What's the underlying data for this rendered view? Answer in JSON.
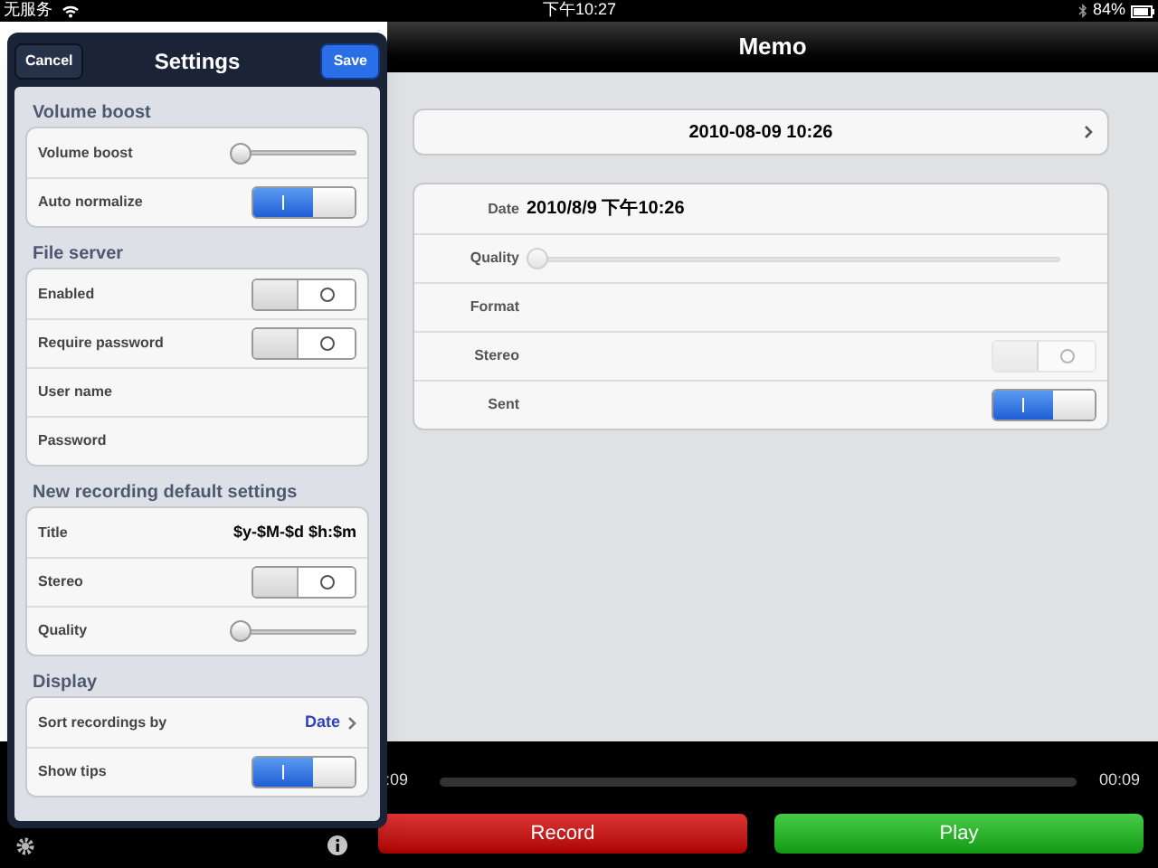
{
  "status_bar": {
    "carrier": "无服务",
    "time": "下午10:27",
    "battery": "84%"
  },
  "nav_bar": {
    "title": "Memo"
  },
  "memo": {
    "title_button": "2010-08-09 10:26",
    "details": [
      {
        "kind": "text",
        "label": "Date",
        "value": "2010/8/9 下午10:26"
      },
      {
        "kind": "slider",
        "label": "Quality",
        "level": 0,
        "disabled": true
      },
      {
        "kind": "text",
        "label": "Format"
      },
      {
        "kind": "switch",
        "label": "Stereo",
        "on": false,
        "disabled": true
      },
      {
        "kind": "switch",
        "label": "Sent",
        "on": true,
        "disabled": false
      }
    ]
  },
  "player": {
    "elapsed": ":09",
    "total": "00:09",
    "buttons": [
      {
        "label": "Record",
        "kind": "record"
      },
      {
        "label": "Play",
        "kind": "play"
      }
    ]
  },
  "settings": {
    "title": "Settings",
    "cancel": "Cancel",
    "save": "Save",
    "sections": [
      {
        "title": "Volume boost",
        "rows": [
          {
            "kind": "slider",
            "label": "Volume boost",
            "level": 0
          },
          {
            "kind": "switch",
            "label": "Auto normalize",
            "on": true
          }
        ]
      },
      {
        "title": "File server",
        "rows": [
          {
            "kind": "switch",
            "label": "Enabled",
            "on": false
          },
          {
            "kind": "switch",
            "label": "Require password",
            "on": false
          },
          {
            "kind": "text",
            "label": "User name"
          },
          {
            "kind": "text",
            "label": "Password"
          }
        ]
      },
      {
        "title": "New recording default settings",
        "rows": [
          {
            "kind": "text",
            "label": "Title",
            "value": "$y-$M-$d $h:$m"
          },
          {
            "kind": "switch",
            "label": "Stereo",
            "on": false
          },
          {
            "kind": "slider",
            "label": "Quality",
            "level": 0
          }
        ]
      },
      {
        "title": "Display",
        "rows": [
          {
            "kind": "link",
            "label": "Sort recordings by",
            "value": "Date"
          },
          {
            "kind": "switch",
            "label": "Show tips",
            "on": true
          }
        ]
      }
    ]
  }
}
